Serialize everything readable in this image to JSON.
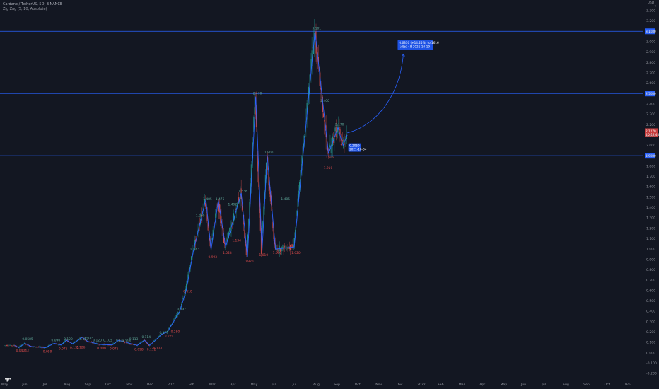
{
  "legend": {
    "title": "Cardano / TetherUS, 5D, BINANCE",
    "indicator": "Zig Zag (5, 10, Absolute)"
  },
  "axis_currency": "USDT",
  "axis_currency_sub": "▾",
  "price_ticks": [
    "3.300",
    "3.200",
    "3.100",
    "3.000",
    "2.900",
    "2.800",
    "2.700",
    "2.600",
    "2.500",
    "2.400",
    "2.300",
    "2.200",
    "2.100",
    "2.000",
    "1.900",
    "1.800",
    "1.700",
    "1.600",
    "1.500",
    "1.400",
    "1.300",
    "1.200",
    "1.100",
    "1.000",
    "0.900",
    "0.800",
    "0.700",
    "0.600",
    "0.500",
    "0.400",
    "0.300",
    "0.200",
    "0.100",
    "0.000",
    "-0.100",
    "-0.200"
  ],
  "time_ticks": [
    "May",
    "Jun",
    "Jul",
    "Aug",
    "Sep",
    "Oct",
    "Nov",
    "Dec",
    "2021",
    "Feb",
    "Mar",
    "Apr",
    "May",
    "Jun",
    "Jul",
    "Aug",
    "Sep",
    "Oct",
    "Nov",
    "Dec",
    "2022",
    "Feb",
    "Mar",
    "Apr",
    "May",
    "Jun",
    "Jul",
    "Aug",
    "Sep",
    "Oct",
    "Nov"
  ],
  "levels": [
    {
      "price": 3.1,
      "label": "3.1000",
      "color": "#2962ff"
    },
    {
      "price": 2.5,
      "label": "2.5000",
      "color": "#2962ff"
    },
    {
      "price": 1.9,
      "label": "1.9000",
      "color": "#2962ff"
    }
  ],
  "current_price": {
    "price": 2.13,
    "label": "2.1270",
    "countdown": "1D 12:40"
  },
  "target_callout": {
    "line1": "0.6330 (+14.25%) to 1616",
    "line2": "1d(b) · 8 2021-10-19"
  },
  "price_box": {
    "line1": "0.2059",
    "line2": "2021-10-04"
  },
  "zigzag_labels": [
    {
      "t": 0.7,
      "p": 0.06,
      "text": "0.04043",
      "kind": "lo"
    },
    {
      "t": 1.0,
      "p": 0.1,
      "text": "0.0585",
      "kind": "hi"
    },
    {
      "t": 2.0,
      "p": 0.05,
      "text": "0.059",
      "kind": "lo"
    },
    {
      "t": 2.4,
      "p": 0.09,
      "text": "0.090",
      "kind": "hi"
    },
    {
      "t": 2.75,
      "p": 0.075,
      "text": "0.075",
      "kind": "lo"
    },
    {
      "t": 3.0,
      "p": 0.1,
      "text": "0.120",
      "kind": "hi"
    },
    {
      "t": 3.3,
      "p": 0.085,
      "text": "0.115",
      "kind": "lo"
    },
    {
      "t": 3.6,
      "p": 0.09,
      "text": "0.126",
      "kind": "lo"
    },
    {
      "t": 3.75,
      "p": 0.1,
      "text": "0.153",
      "kind": "hi"
    },
    {
      "t": 4.0,
      "p": 0.11,
      "text": "0.145",
      "kind": "hi"
    },
    {
      "t": 4.4,
      "p": 0.09,
      "text": "0.120",
      "kind": "hi"
    },
    {
      "t": 4.6,
      "p": 0.08,
      "text": "0.089",
      "kind": "lo"
    },
    {
      "t": 4.9,
      "p": 0.09,
      "text": "0.105",
      "kind": "hi"
    },
    {
      "t": 5.2,
      "p": 0.075,
      "text": "0.075",
      "kind": "lo"
    },
    {
      "t": 5.5,
      "p": 0.09,
      "text": "0.117",
      "kind": "hi"
    },
    {
      "t": 5.8,
      "p": 0.08,
      "text": "0.114",
      "kind": "hi"
    },
    {
      "t": 6.15,
      "p": 0.1,
      "text": "0.113",
      "kind": "hi"
    },
    {
      "t": 6.4,
      "p": 0.07,
      "text": "0.098",
      "kind": "lo"
    },
    {
      "t": 6.75,
      "p": 0.12,
      "text": "0.114",
      "kind": "hi"
    },
    {
      "t": 7.0,
      "p": 0.07,
      "text": "0.112",
      "kind": "lo"
    },
    {
      "t": 7.3,
      "p": 0.08,
      "text": "0.124",
      "kind": "lo"
    },
    {
      "t": 7.6,
      "p": 0.16,
      "text": "0.179",
      "kind": "hi"
    },
    {
      "t": 7.85,
      "p": 0.2,
      "text": "0.229",
      "kind": "lo"
    },
    {
      "t": 8.15,
      "p": 0.24,
      "text": "0.280",
      "kind": "lo"
    },
    {
      "t": 8.45,
      "p": 0.39,
      "text": "0.397",
      "kind": "hi"
    },
    {
      "t": 8.75,
      "p": 0.63,
      "text": "0.610",
      "kind": "lo"
    },
    {
      "t": 9.1,
      "p": 0.97,
      "text": "0.983",
      "kind": "hi"
    },
    {
      "t": 9.35,
      "p": 1.29,
      "text": "1.200",
      "kind": "hi"
    },
    {
      "t": 9.7,
      "p": 1.45,
      "text": "1.485",
      "kind": "hi"
    },
    {
      "t": 9.95,
      "p": 0.96,
      "text": "0.993",
      "kind": "lo"
    },
    {
      "t": 10.3,
      "p": 1.45,
      "text": "1.475",
      "kind": "hi"
    },
    {
      "t": 10.65,
      "p": 1.0,
      "text": "1.028",
      "kind": "lo"
    },
    {
      "t": 10.9,
      "p": 1.4,
      "text": "1.402",
      "kind": "hi"
    },
    {
      "t": 11.1,
      "p": 1.12,
      "text": "1.134",
      "kind": "lo"
    },
    {
      "t": 11.4,
      "p": 1.53,
      "text": "1.538",
      "kind": "hi"
    },
    {
      "t": 11.7,
      "p": 0.92,
      "text": "0.920",
      "kind": "lo"
    },
    {
      "t": 12.1,
      "p": 2.47,
      "text": "2.470",
      "kind": "hi"
    },
    {
      "t": 12.4,
      "p": 0.98,
      "text": "1.010",
      "kind": "lo"
    },
    {
      "t": 12.65,
      "p": 1.9,
      "text": "1.900",
      "kind": "hi"
    },
    {
      "t": 13.05,
      "p": 1.0,
      "text": "1.000",
      "kind": "lo"
    },
    {
      "t": 13.45,
      "p": 1.45,
      "text": "1.485",
      "kind": "hi"
    },
    {
      "t": 13.95,
      "p": 1.0,
      "text": "1.020",
      "kind": "lo"
    },
    {
      "t": 14.95,
      "p": 3.1,
      "text": "3.101",
      "kind": "hi"
    },
    {
      "t": 15.35,
      "p": 2.4,
      "text": "2.400",
      "kind": "hi"
    },
    {
      "t": 15.6,
      "p": 1.92,
      "text": "1.919",
      "kind": "lo"
    },
    {
      "t": 16.05,
      "p": 2.17,
      "text": "2.170",
      "kind": "hi"
    },
    {
      "t": 15.5,
      "p": 1.82,
      "text": "1.910",
      "kind": "lo"
    }
  ],
  "chart_data": {
    "type": "line",
    "title": "Cardano / TetherUS, 5D, BINANCE",
    "series": [
      {
        "name": "Zig Zag (5, 10, Absolute)",
        "x": [
          "2020-05",
          "2020-05",
          "2020-06",
          "2020-06",
          "2020-07",
          "2020-07",
          "2020-08",
          "2020-08",
          "2020-09",
          "2020-09",
          "2020-10",
          "2020-10",
          "2020-11",
          "2020-11",
          "2020-12",
          "2020-12",
          "2021-01",
          "2021-01",
          "2021-02",
          "2021-02",
          "2021-02",
          "2021-03",
          "2021-03",
          "2021-03",
          "2021-04",
          "2021-04",
          "2021-05",
          "2021-05",
          "2021-06",
          "2021-06",
          "2021-07",
          "2021-07",
          "2021-08",
          "2021-08",
          "2021-09",
          "2021-09",
          "2021-10",
          "2021-10"
        ],
        "t": [
          0.5,
          0.7,
          1.0,
          1.3,
          2.0,
          2.4,
          2.75,
          3.0,
          3.3,
          3.75,
          4.0,
          4.6,
          5.2,
          5.5,
          6.4,
          6.75,
          7.0,
          7.6,
          7.85,
          8.45,
          8.75,
          9.1,
          9.7,
          9.95,
          10.3,
          10.65,
          11.4,
          11.7,
          12.1,
          12.4,
          12.65,
          13.05,
          13.95,
          14.95,
          15.6,
          16.05,
          16.3,
          16.5
        ],
        "values": [
          0.07,
          0.05,
          0.09,
          0.06,
          0.05,
          0.09,
          0.075,
          0.12,
          0.085,
          0.15,
          0.11,
          0.08,
          0.075,
          0.12,
          0.07,
          0.12,
          0.07,
          0.18,
          0.2,
          0.4,
          0.6,
          0.98,
          1.48,
          0.99,
          1.47,
          1.02,
          1.54,
          0.92,
          2.47,
          0.98,
          1.9,
          1.0,
          1.02,
          3.1,
          1.92,
          2.17,
          2.0,
          2.1
        ]
      }
    ],
    "price_candles_approx": {
      "t": [
        13.95,
        14.2,
        14.45,
        14.6,
        14.75,
        14.85,
        14.95,
        15.05,
        15.15,
        15.25,
        15.35,
        15.45,
        15.55,
        15.65,
        15.75,
        15.85,
        15.95,
        16.05,
        16.15,
        16.25,
        16.35,
        16.45
      ],
      "close": [
        1.1,
        1.4,
        1.9,
        2.5,
        2.9,
        2.8,
        3.0,
        2.85,
        2.7,
        2.5,
        2.4,
        2.2,
        2.0,
        2.3,
        2.1,
        2.2,
        2.15,
        2.17,
        2.0,
        2.05,
        2.1,
        2.12
      ]
    },
    "xlabel": "",
    "ylabel": "",
    "ylim": [
      -0.2,
      3.32
    ],
    "grid": false,
    "legend": "top-left"
  }
}
